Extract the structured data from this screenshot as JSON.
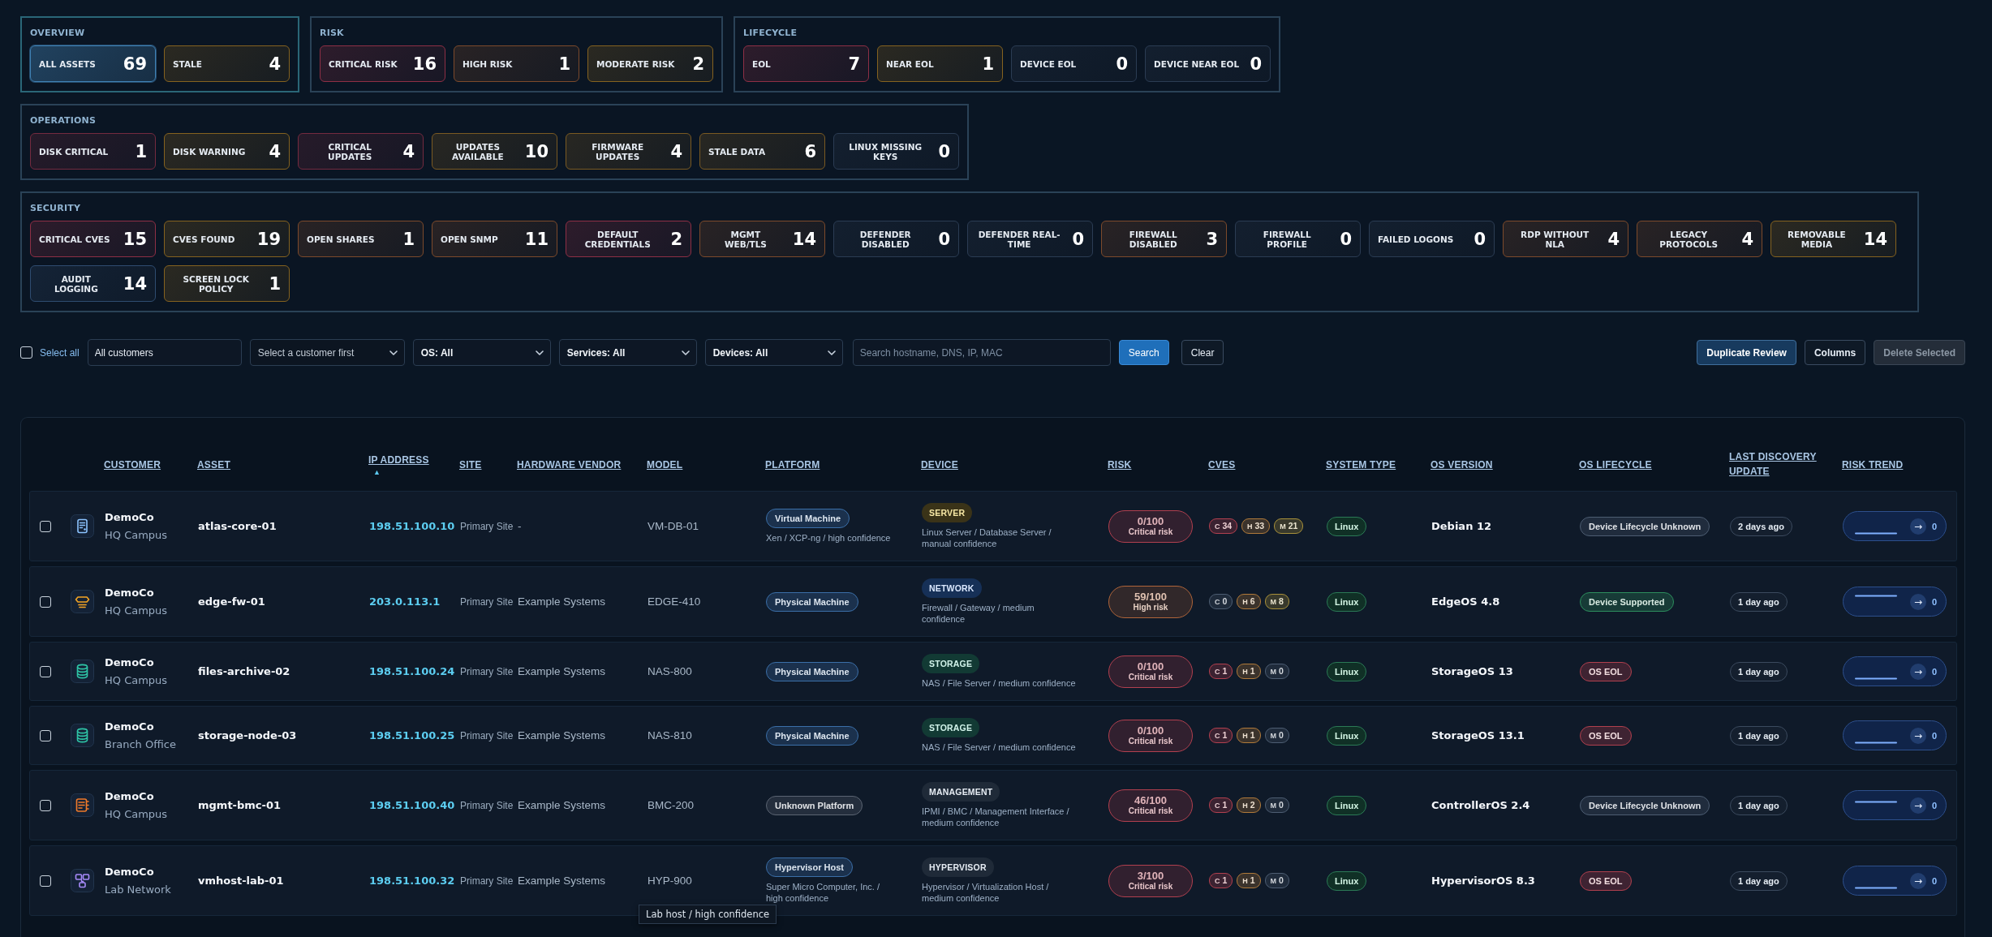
{
  "summary_groups": [
    {
      "title": "OVERVIEW",
      "cards": [
        {
          "label": "ALL ASSETS",
          "count": "69",
          "color": "#3f80b3",
          "selected": true
        },
        {
          "label": "STALE",
          "count": "4",
          "color": "#85621f",
          "selected": false
        }
      ]
    },
    {
      "title": "RISK",
      "cards": [
        {
          "label": "CRITICAL RISK",
          "count": "16",
          "color": "#8e2f45",
          "selected": false
        },
        {
          "label": "HIGH RISK",
          "count": "1",
          "color": "#7d4a2b",
          "selected": false
        },
        {
          "label": "MODERATE RISK",
          "count": "2",
          "color": "#85621f",
          "selected": false
        }
      ]
    },
    {
      "title": "LIFECYCLE",
      "cards": [
        {
          "label": "EOL",
          "count": "7",
          "color": "#8e2f45",
          "selected": false
        },
        {
          "label": "NEAR EOL",
          "count": "1",
          "color": "#85621f",
          "selected": false
        },
        {
          "label": "DEVICE EOL",
          "count": "0",
          "color": "#2b3c53",
          "selected": false
        },
        {
          "label": "DEVICE NEAR EOL",
          "count": "0",
          "color": "#2b3c53",
          "selected": false
        }
      ]
    },
    {
      "title": "OPERATIONS",
      "cards": [
        {
          "label": "DISK CRITICAL",
          "count": "1",
          "color": "#742a3f",
          "selected": false
        },
        {
          "label": "DISK WARNING",
          "count": "4",
          "color": "#85621f",
          "selected": false
        },
        {
          "label": "CRITICAL UPDATES",
          "count": "4",
          "color": "#742a3f",
          "selected": false
        },
        {
          "label": "UPDATES AVAILABLE",
          "count": "10",
          "color": "#7a5a22",
          "selected": false
        },
        {
          "label": "FIRMWARE UPDATES",
          "count": "4",
          "color": "#7a5a22",
          "selected": false
        },
        {
          "label": "STALE DATA",
          "count": "6",
          "color": "#7a5a22",
          "selected": false
        },
        {
          "label": "LINUX MISSING KEYS",
          "count": "0",
          "color": "#2b3c53",
          "selected": false
        }
      ]
    },
    {
      "title": "SECURITY",
      "cards": [
        {
          "label": "CRITICAL CVES",
          "count": "15",
          "color": "#8e2f45",
          "selected": false
        },
        {
          "label": "CVES FOUND",
          "count": "19",
          "color": "#85621f",
          "selected": false
        },
        {
          "label": "OPEN SHARES",
          "count": "1",
          "color": "#7d4a2b",
          "selected": false
        },
        {
          "label": "OPEN SNMP",
          "count": "11",
          "color": "#7d4a2b",
          "selected": false
        },
        {
          "label": "DEFAULT CREDENTIALS",
          "count": "2",
          "color": "#8e2f45",
          "selected": false
        },
        {
          "label": "MGMT WEB/TLS",
          "count": "14",
          "color": "#7d4a2b",
          "selected": false
        },
        {
          "label": "DEFENDER DISABLED",
          "count": "0",
          "color": "#2b3c53",
          "selected": false
        },
        {
          "label": "DEFENDER REAL-TIME",
          "count": "0",
          "color": "#2b3c53",
          "selected": false
        },
        {
          "label": "FIREWALL DISABLED",
          "count": "3",
          "color": "#7d4a2b",
          "selected": false
        },
        {
          "label": "FIREWALL PROFILE",
          "count": "0",
          "color": "#2b3c53",
          "selected": false
        },
        {
          "label": "FAILED LOGONS",
          "count": "0",
          "color": "#2b3c53",
          "selected": false
        },
        {
          "label": "RDP WITHOUT NLA",
          "count": "4",
          "color": "#7d4a2b",
          "selected": false
        },
        {
          "label": "LEGACY PROTOCOLS",
          "count": "4",
          "color": "#7d4a2b",
          "selected": false
        },
        {
          "label": "REMOVABLE MEDIA",
          "count": "14",
          "color": "#85621f",
          "selected": false
        },
        {
          "label": "AUDIT LOGGING",
          "count": "14",
          "color": "#2f4c70",
          "selected": false
        },
        {
          "label": "SCREEN LOCK POLICY",
          "count": "1",
          "color": "#85621f",
          "selected": false
        }
      ]
    }
  ],
  "filters": {
    "select_all": {
      "label": "Select all",
      "checked": false
    },
    "customer": {
      "value": "All customers"
    },
    "selects": [
      {
        "value": "Select a customer first",
        "disabled": true
      },
      {
        "value": "OS: All",
        "disabled": false
      },
      {
        "value": "Services: All",
        "disabled": false
      },
      {
        "value": "Devices: All",
        "disabled": false
      }
    ],
    "search": {
      "placeholder": "Search hostname, DNS, IP, MAC"
    },
    "buttons": [
      {
        "label": "Search",
        "kind": "primary"
      },
      {
        "label": "Clear",
        "kind": "secondary"
      }
    ]
  },
  "actions": [
    {
      "label": "Duplicate Review",
      "kind": "accent",
      "disabled": false
    },
    {
      "label": "Columns",
      "kind": "secondary",
      "disabled": false
    },
    {
      "label": "Delete Selected",
      "kind": "secondary",
      "disabled": true
    }
  ],
  "table": {
    "columns": [
      {
        "label": "CUSTOMER"
      },
      {
        "label": "ASSET"
      },
      {
        "label": "IP ADDRESS",
        "sort_indicator": "▲"
      },
      {
        "label": "SITE"
      },
      {
        "label": "HARDWARE VENDOR"
      },
      {
        "label": "MODEL"
      },
      {
        "label": "PLATFORM"
      },
      {
        "label": "DEVICE"
      },
      {
        "label": "RISK"
      },
      {
        "label": "CVES"
      },
      {
        "label": "SYSTEM TYPE"
      },
      {
        "label": "OS VERSION"
      },
      {
        "label": "OS LIFECYCLE"
      },
      {
        "label": "LAST DISCOVERY UPDATE"
      },
      {
        "label": "RISK TREND"
      }
    ],
    "rows": [
      {
        "checked": false,
        "customer": {
          "name": "DemoCo",
          "location": "HQ Campus"
        },
        "asset": "atlas-core-01",
        "ip": "198.51.100.10",
        "site": "Primary Site",
        "vendor": "-",
        "model": "VM-DB-01",
        "platform": {
          "label": "Virtual Machine",
          "detail": "Xen / XCP-ng / high confidence",
          "color": "#3b6fa8"
        },
        "device": {
          "kind": "server",
          "label": "SERVER",
          "detail": "Linux Server / Database Server / manual confidence"
        },
        "risk": {
          "score": "0/100",
          "label": "Critical risk",
          "color": "#b2404f"
        },
        "cves": [
          {
            "letter": "C",
            "count": "34",
            "color": "#b2404f"
          },
          {
            "letter": "H",
            "count": "33",
            "color": "#b07a3a"
          },
          {
            "letter": "M",
            "count": "21",
            "color": "#a8913a"
          }
        ],
        "system_type": "Linux",
        "os_version": "Debian 12",
        "lifecycle": {
          "label": "Device Lifecycle Unknown",
          "color": "#4d5d72"
        },
        "last_discovery": "2 days ago",
        "trend": {
          "kind": "low",
          "arrow": "→",
          "delta": "0"
        }
      },
      {
        "checked": false,
        "customer": {
          "name": "DemoCo",
          "location": "HQ Campus"
        },
        "asset": "edge-fw-01",
        "ip": "203.0.113.1",
        "site": "Primary Site",
        "vendor": "Example Systems",
        "model": "EDGE-410",
        "platform": {
          "label": "Physical Machine",
          "color": "#3b6fa8"
        },
        "device": {
          "kind": "network",
          "label": "NETWORK",
          "detail": "Firewall / Gateway / medium confidence"
        },
        "risk": {
          "score": "59/100",
          "label": "High risk",
          "color": "#b0653a"
        },
        "cves": [
          {
            "letter": "C",
            "count": "0",
            "color": "#4d5d72"
          },
          {
            "letter": "H",
            "count": "6",
            "color": "#b07a3a"
          },
          {
            "letter": "M",
            "count": "8",
            "color": "#a8913a"
          }
        ],
        "system_type": "Linux",
        "os_version": "EdgeOS 4.8",
        "lifecycle": {
          "label": "Device Supported",
          "color": "#2d8f5e"
        },
        "last_discovery": "1 day ago",
        "trend": {
          "kind": "high",
          "arrow": "→",
          "delta": "0"
        }
      },
      {
        "checked": false,
        "customer": {
          "name": "DemoCo",
          "location": "HQ Campus"
        },
        "asset": "files-archive-02",
        "ip": "198.51.100.24",
        "site": "Primary Site",
        "vendor": "Example Systems",
        "model": "NAS-800",
        "platform": {
          "label": "Physical Machine",
          "color": "#3b6fa8"
        },
        "device": {
          "kind": "storage",
          "label": "STORAGE",
          "detail": "NAS / File Server / medium confidence"
        },
        "risk": {
          "score": "0/100",
          "label": "Critical risk",
          "color": "#b2404f"
        },
        "cves": [
          {
            "letter": "C",
            "count": "1",
            "color": "#b2404f"
          },
          {
            "letter": "H",
            "count": "1",
            "color": "#b07a3a"
          },
          {
            "letter": "M",
            "count": "0",
            "color": "#4d5d72"
          }
        ],
        "system_type": "Linux",
        "os_version": "StorageOS 13",
        "lifecycle": {
          "label": "OS EOL",
          "color": "#b0404e"
        },
        "last_discovery": "1 day ago",
        "trend": {
          "kind": "low",
          "arrow": "→",
          "delta": "0"
        }
      },
      {
        "checked": false,
        "customer": {
          "name": "DemoCo",
          "location": "Branch Office"
        },
        "asset": "storage-node-03",
        "ip": "198.51.100.25",
        "site": "Primary Site",
        "vendor": "Example Systems",
        "model": "NAS-810",
        "platform": {
          "label": "Physical Machine",
          "color": "#3b6fa8"
        },
        "device": {
          "kind": "storage",
          "label": "STORAGE",
          "detail": "NAS / File Server / medium confidence"
        },
        "risk": {
          "score": "0/100",
          "label": "Critical risk",
          "color": "#b2404f"
        },
        "cves": [
          {
            "letter": "C",
            "count": "1",
            "color": "#b2404f"
          },
          {
            "letter": "H",
            "count": "1",
            "color": "#b07a3a"
          },
          {
            "letter": "M",
            "count": "0",
            "color": "#4d5d72"
          }
        ],
        "system_type": "Linux",
        "os_version": "StorageOS 13.1",
        "lifecycle": {
          "label": "OS EOL",
          "color": "#b0404e"
        },
        "last_discovery": "1 day ago",
        "trend": {
          "kind": "low",
          "arrow": "→",
          "delta": "0"
        }
      },
      {
        "checked": false,
        "customer": {
          "name": "DemoCo",
          "location": "HQ Campus"
        },
        "asset": "mgmt-bmc-01",
        "ip": "198.51.100.40",
        "site": "Primary Site",
        "vendor": "Example Systems",
        "model": "BMC-200",
        "platform": {
          "label": "Unknown Platform",
          "color": "#5b6472"
        },
        "device": {
          "kind": "management",
          "label": "MANAGEMENT",
          "detail": "IPMI / BMC / Management Interface / medium confidence"
        },
        "risk": {
          "score": "46/100",
          "label": "Critical risk",
          "color": "#b2404f"
        },
        "cves": [
          {
            "letter": "C",
            "count": "1",
            "color": "#b2404f"
          },
          {
            "letter": "H",
            "count": "2",
            "color": "#b07a3a"
          },
          {
            "letter": "M",
            "count": "0",
            "color": "#4d5d72"
          }
        ],
        "system_type": "Linux",
        "os_version": "ControllerOS 2.4",
        "lifecycle": {
          "label": "Device Lifecycle Unknown",
          "color": "#4d5d72"
        },
        "last_discovery": "1 day ago",
        "trend": {
          "kind": "mid",
          "arrow": "→",
          "delta": "0"
        }
      },
      {
        "checked": false,
        "customer": {
          "name": "DemoCo",
          "location": "Lab Network"
        },
        "asset": "vmhost-lab-01",
        "ip": "198.51.100.32",
        "site": "Primary Site",
        "vendor": "Example Systems",
        "model": "HYP-900",
        "tooltip": "Lab host / high confidence",
        "platform": {
          "label": "Hypervisor Host",
          "detail": "Super Micro Computer, Inc. / high confidence",
          "color": "#3b6fa8"
        },
        "device": {
          "kind": "hypervisor",
          "label": "HYPERVISOR",
          "detail": "Hypervisor / Virtualization Host / medium confidence"
        },
        "risk": {
          "score": "3/100",
          "label": "Critical risk",
          "color": "#b2404f"
        },
        "cves": [
          {
            "letter": "C",
            "count": "1",
            "color": "#b2404f"
          },
          {
            "letter": "H",
            "count": "1",
            "color": "#b07a3a"
          },
          {
            "letter": "M",
            "count": "0",
            "color": "#4d5d72"
          }
        ],
        "system_type": "Linux",
        "os_version": "HypervisorOS 8.3",
        "lifecycle": {
          "label": "OS EOL",
          "color": "#b0404e"
        },
        "last_discovery": "1 day ago",
        "trend": {
          "kind": "low",
          "arrow": "→",
          "delta": "0"
        }
      }
    ]
  }
}
